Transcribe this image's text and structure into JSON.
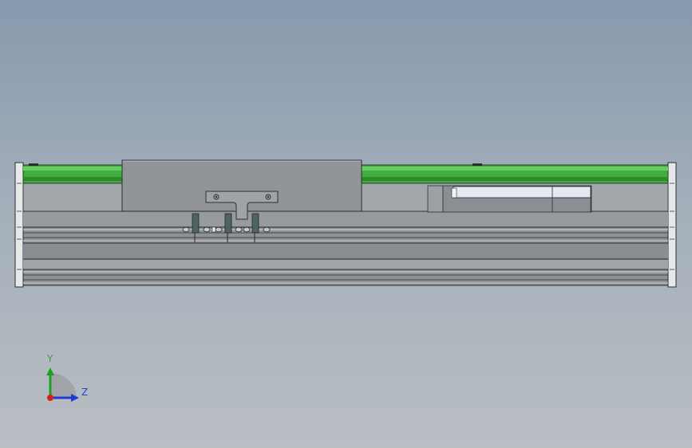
{
  "viewport": {
    "background_top": "#8799ad",
    "background_bottom": "#b9bec3"
  },
  "model": {
    "rail_color": "#3fae3f",
    "body_color": "#8e9296",
    "carriage_color": "#919597",
    "bracket_color": "#4d6460"
  },
  "triad": {
    "y_label": "Y",
    "z_label": "Z",
    "x_axis_color": "#d81e1e",
    "y_axis_color": "#1fa01f",
    "z_axis_color": "#1f3cd0"
  }
}
